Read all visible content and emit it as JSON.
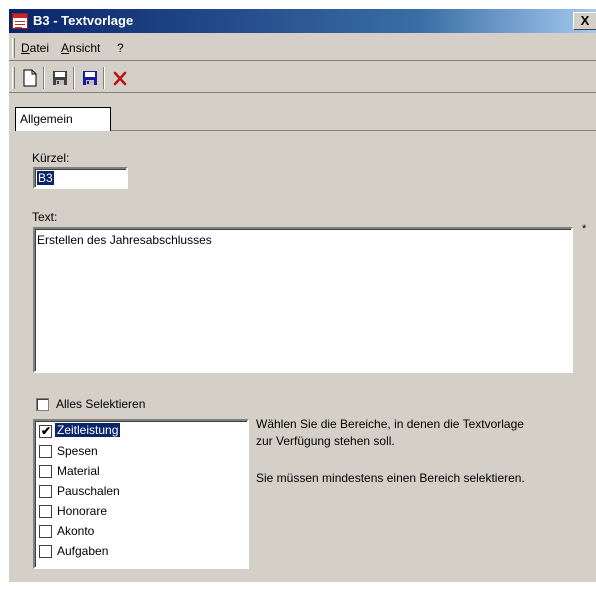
{
  "window": {
    "title": "B3 - Textvorlage",
    "close_label": "X"
  },
  "menu": {
    "datei": {
      "underlined": "D",
      "rest": "atei"
    },
    "ansicht": {
      "underlined": "A",
      "rest": "nsicht"
    },
    "help": "?"
  },
  "toolbar": {
    "icons": [
      "new-document-icon",
      "save-icon",
      "save-as-icon",
      "delete-icon"
    ]
  },
  "tabs": {
    "active": "Allgemein"
  },
  "form": {
    "kuerzel_label": "Kürzel:",
    "kuerzel_value": "B3",
    "text_label": "Text:",
    "text_value": "Erstellen des Jahresabschlusses",
    "required_marker": "*"
  },
  "select_all": {
    "label": "Alles Selektieren",
    "checked": false
  },
  "areas": {
    "items": [
      {
        "label": "Zeitleistung",
        "checked": true
      },
      {
        "label": "Spesen",
        "checked": false
      },
      {
        "label": "Material",
        "checked": false
      },
      {
        "label": "Pauschalen",
        "checked": false
      },
      {
        "label": "Honorare",
        "checked": false
      },
      {
        "label": "Akonto",
        "checked": false
      },
      {
        "label": "Aufgaben",
        "checked": false
      }
    ]
  },
  "info": {
    "line1": "Wählen Sie die Bereiche, in denen die Textvorlage",
    "line2": "zur Verfügung stehen soll.",
    "line3": "Sie müssen mindestens einen Bereich selektieren."
  },
  "colors": {
    "titlebar_start": "#0a246a",
    "titlebar_end": "#a6caf0",
    "face": "#d4d0c8",
    "selection": "#0a246a",
    "delete_red": "#c0141c"
  }
}
